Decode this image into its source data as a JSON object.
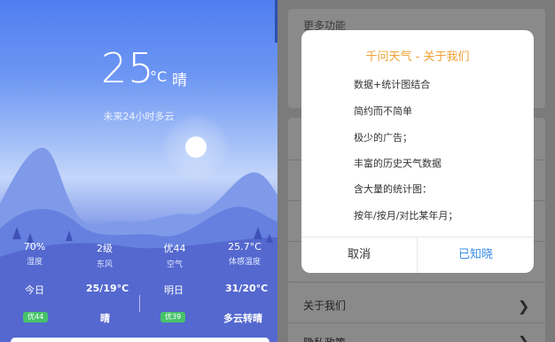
{
  "weather": {
    "temperature": "25",
    "unit": "°C",
    "condition": "晴",
    "forecast_note": "未来24小时多云",
    "stats": [
      {
        "value": "70%",
        "label": "湿度"
      },
      {
        "value": "2级",
        "label": "东风"
      },
      {
        "value": "优44",
        "label": "空气"
      },
      {
        "value": "25.7°C",
        "label": "体感温度"
      }
    ],
    "daily": [
      {
        "day": "今日",
        "range": "25/19°C",
        "aqi": "优44",
        "weather": "晴"
      },
      {
        "day": "明日",
        "range": "31/20°C",
        "aqi": "优39",
        "weather": "多云转晴"
      }
    ]
  },
  "settings": {
    "more_features": "更多功能",
    "about_us": "关于我们",
    "next_item": "隐私政策"
  },
  "dialog": {
    "title": "千问天气 - 关于我们",
    "lines": [
      "数据+统计图结合",
      "简约而不简单",
      "极少的广告；",
      "丰富的历史天气数据",
      "含大量的统计图：",
      "按年/按月/对比某年月；"
    ],
    "cancel": "取消",
    "confirm": "已知晓"
  },
  "colors": {
    "accent_title": "#f0a032",
    "confirm_blue": "#3a8ee6",
    "aqi_green": "#46c36a"
  }
}
